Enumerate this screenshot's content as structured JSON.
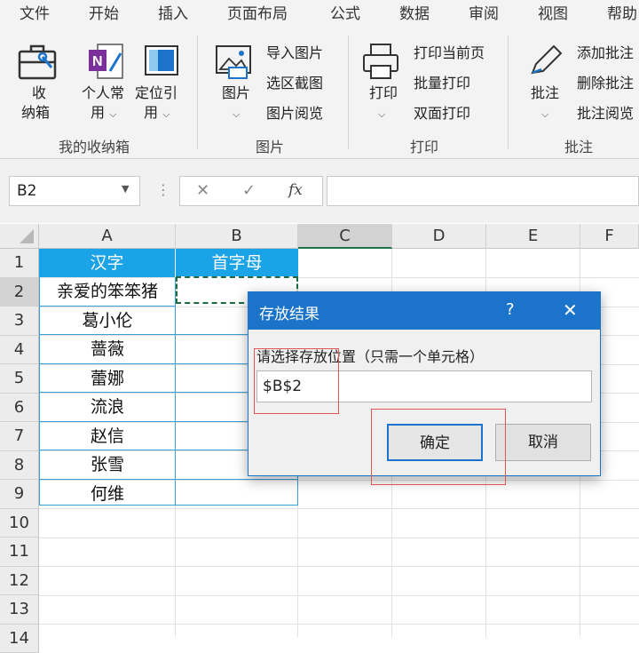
{
  "menu": [
    "文件",
    "开始",
    "插入",
    "页面布局",
    "公式",
    "数据",
    "审阅",
    "视图",
    "帮助"
  ],
  "ribbon": {
    "group1": {
      "label": "我的收纳箱",
      "btn1": {
        "line1": "收",
        "line2": "纳箱"
      },
      "btn2": {
        "line1": "个人常",
        "line2": "用"
      },
      "btn3": {
        "line1": "定位引",
        "line2": "用"
      }
    },
    "group2": {
      "label": "图片",
      "big": "图片",
      "items": [
        "导入图片",
        "选区截图",
        "图片阅览"
      ]
    },
    "group3": {
      "label": "打印",
      "big": "打印",
      "items": [
        "打印当前页",
        "批量打印",
        "双面打印"
      ]
    },
    "group4": {
      "label": "批注",
      "big": "批注",
      "items": [
        "添加批注",
        "删除批注",
        "批注阅览"
      ]
    }
  },
  "formula_bar": {
    "name_box": "B2",
    "cancel": "✕",
    "enter": "✓",
    "fx": "fx",
    "value": ""
  },
  "columns": [
    "A",
    "B",
    "C",
    "D",
    "E",
    "F"
  ],
  "rows": [
    "1",
    "2",
    "3",
    "4",
    "5",
    "6",
    "7",
    "8",
    "9",
    "10",
    "11",
    "12",
    "13",
    "14"
  ],
  "table": {
    "header_a": "汉字",
    "header_b": "首字母",
    "names": [
      "亲爱的笨笨猪",
      "葛小伦",
      "蔷薇",
      "蕾娜",
      "流浪",
      "赵信",
      "张雪",
      "何维"
    ]
  },
  "dialog": {
    "title": "存放结果",
    "help": "?",
    "close": "✕",
    "prompt": "请选择存放位置（只需一个单元格）",
    "input_value": "$B$2",
    "ok": "确定",
    "cancel": "取消"
  },
  "colors": {
    "accent": "#1b74c9",
    "table_header": "#1aa3e6",
    "highlight": "#e05555"
  }
}
